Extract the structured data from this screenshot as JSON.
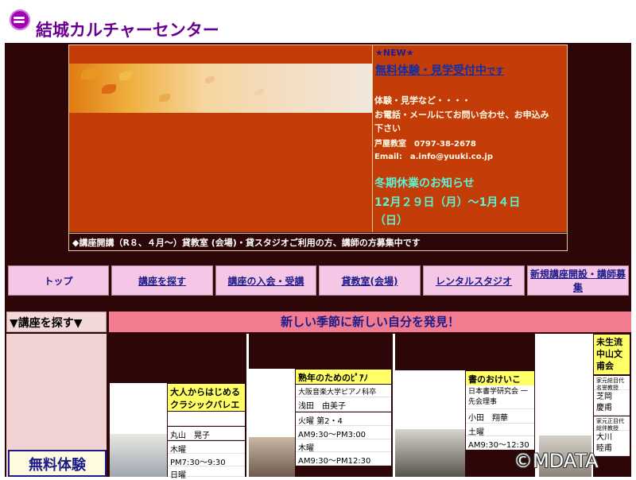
{
  "site": {
    "title": "結城カルチャーセンター",
    "logo_icon": "logo-swirl-icon"
  },
  "hero": {
    "new_label": "★NEW★",
    "promo_main": "無料体験・見学受付中",
    "promo_suffix": "です",
    "info_lines": [
      "体験・見学など・・・・",
      "お電話・メールにてお問い合わせ、お申込み",
      "下さい",
      "芦屋教室　0797-38-2678",
      "Email:　a.info@yuuki.co.jp"
    ],
    "notice_title": "冬期休業のお知らせ",
    "notice_line1": "12月２９日（月）～1月４日",
    "notice_line2": "（日）",
    "ticker": "◆講座開講（R８、４月～）貸教室 (会場)・貸スタジオご利用の方、講師の方募集中です"
  },
  "nav": [
    "トップ",
    "講座を探す",
    "講座の入会・受講",
    "貸教室(会場)",
    "レンタルスタジオ",
    "新規講座開設・講師募集"
  ],
  "search_header": "▼講座を探す▼",
  "banner": "新しい季節に新しい自分を発見！",
  "free_trial": "無料体験",
  "courses": [
    {
      "title": "大人からはじめるクラシックバレエ",
      "instructor": "丸山　晃子",
      "schedule": [
        "木曜",
        "PM7:30～9:30",
        "日曜"
      ]
    },
    {
      "title": "熟年のためのﾋﾟｱﾉ",
      "affiliation": "大阪音楽大学ピアノ科卒",
      "instructor": "浅田　由美子",
      "schedule": [
        "火曜 第2・4",
        "AM9:30～PM3:00",
        "木曜",
        "AM9:30～PM12:30"
      ]
    },
    {
      "title": "書のおけいこ",
      "affiliation": "日本書学研究会 一先会理事",
      "instructor": "小田　翔華",
      "schedule": [
        "土曜",
        "AM9:30～12:30"
      ]
    },
    {
      "title": "未生流中山文甫会",
      "affiliation1": "家元総目代名誉教授",
      "instructor1": "芝岡　慶甫",
      "affiliation2": "家元正目代総伴教授",
      "instructor2": "大川　睦甫"
    }
  ],
  "watermark": "©MDATA",
  "colors": {
    "brand": "#6a0090",
    "hero_bg": "#c43d08",
    "frame": "#2d0708",
    "nav_bg": "#f6c6e6",
    "banner": "#f27b8f",
    "notice": "#5ef2d2",
    "course_title_bg": "#ffff66"
  }
}
